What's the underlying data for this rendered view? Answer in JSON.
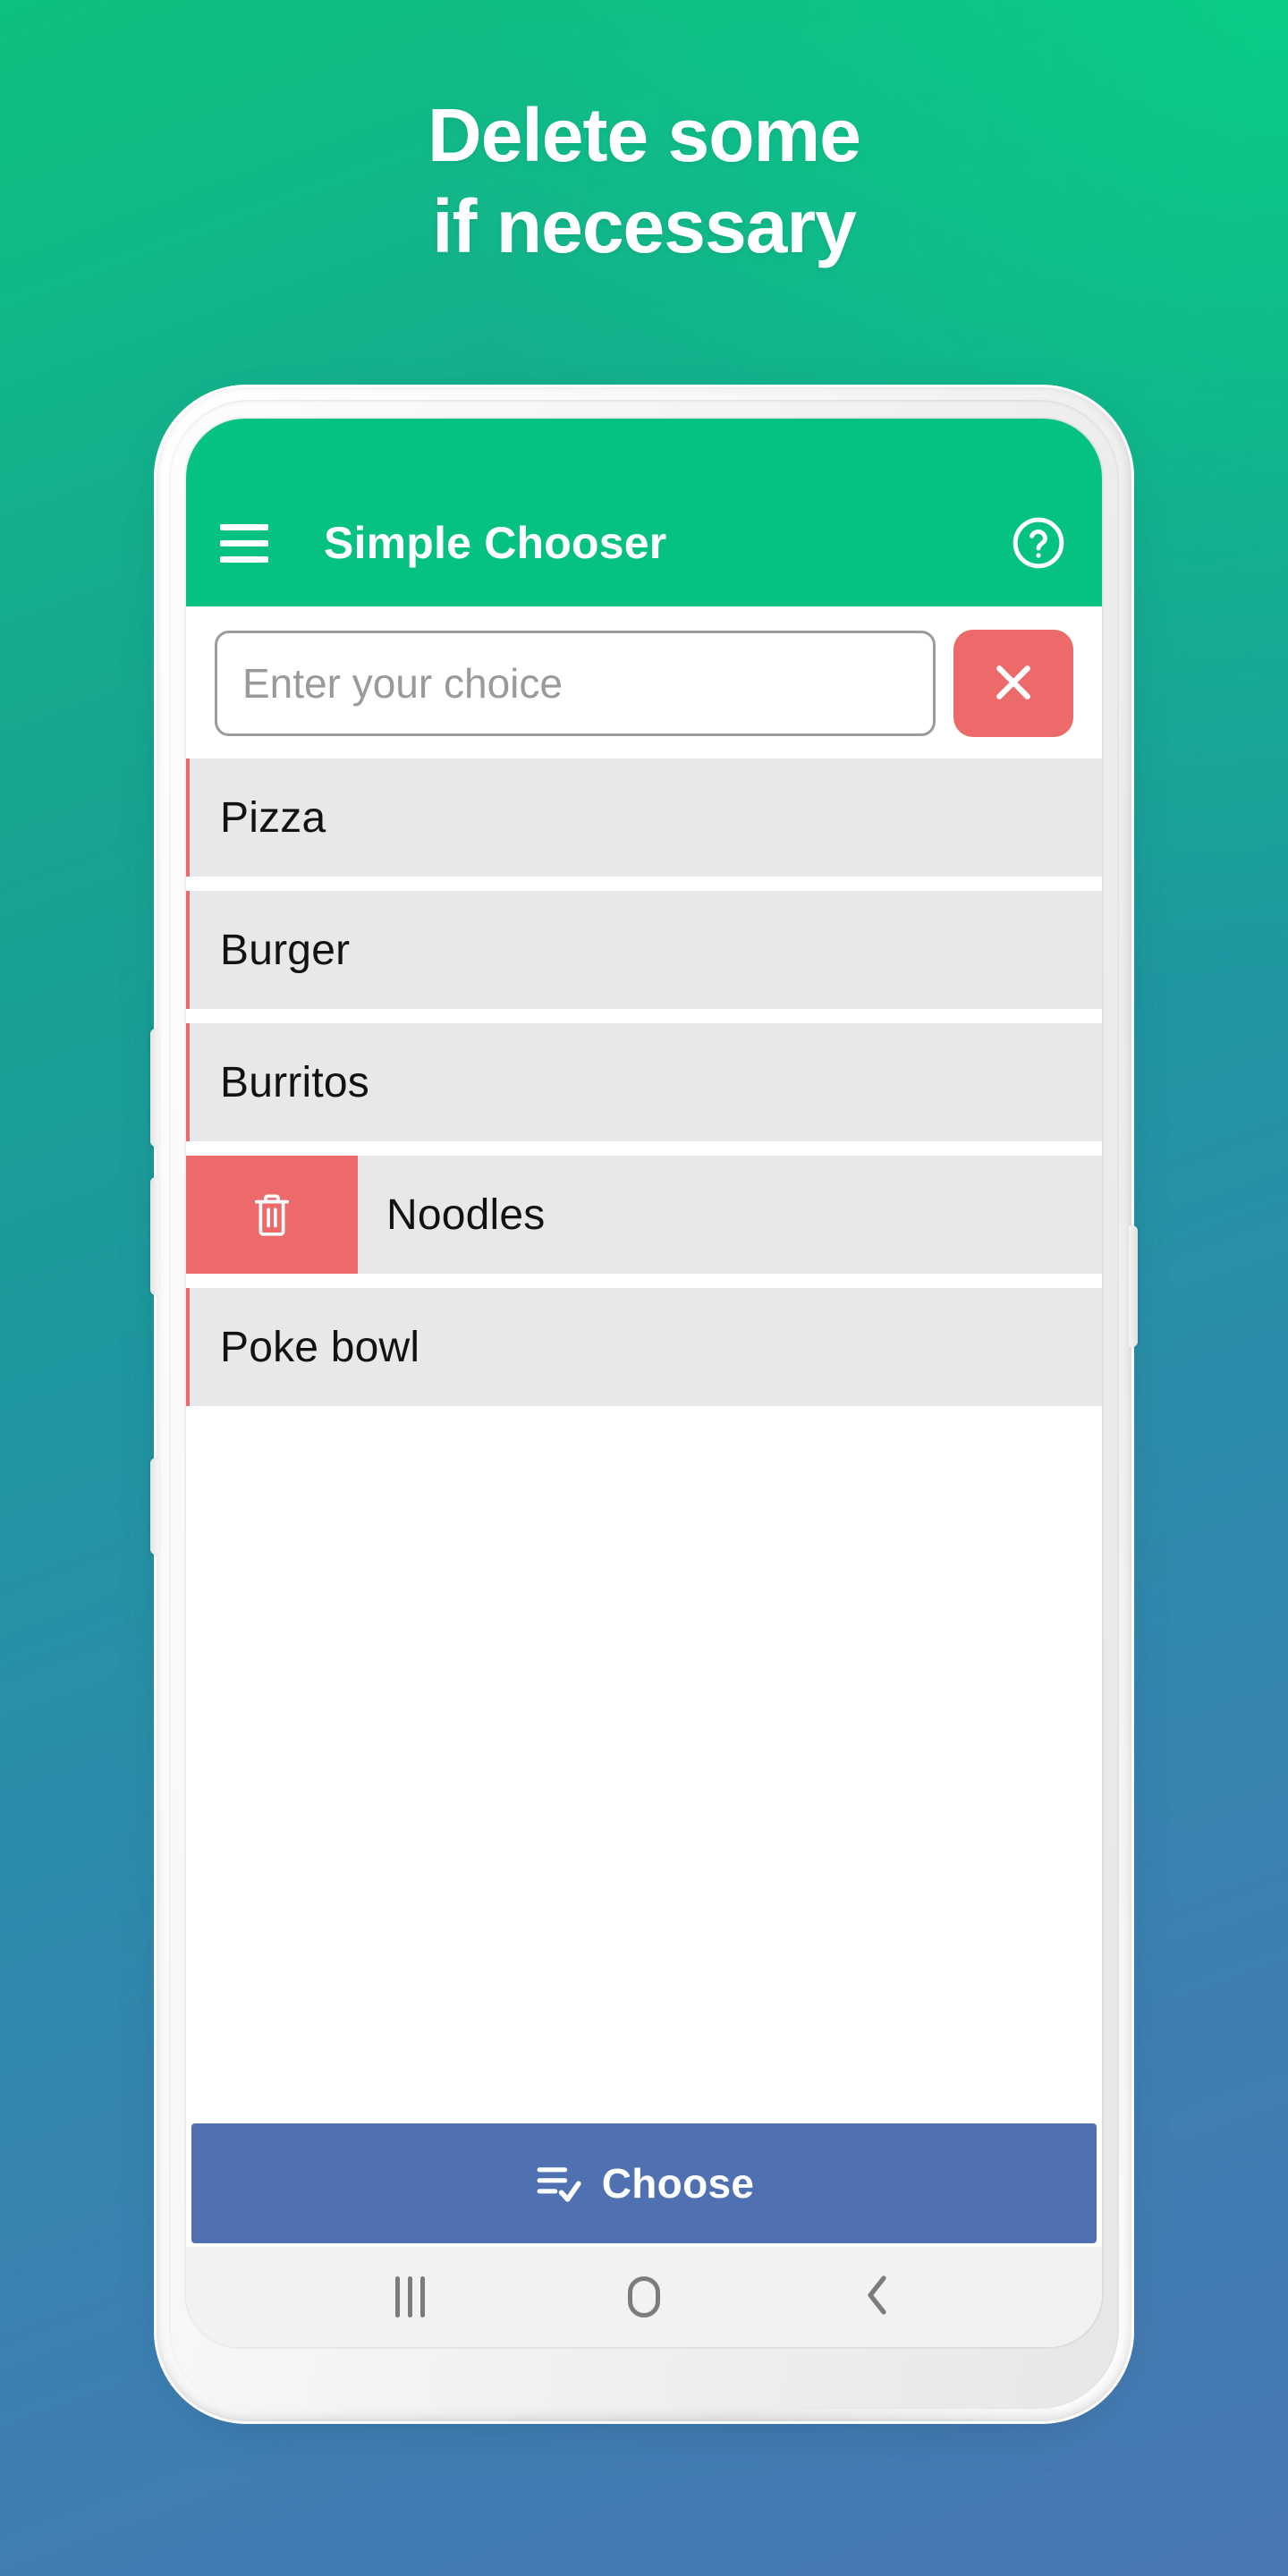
{
  "promo": {
    "headline_line1": "Delete some",
    "headline_line2": "if necessary",
    "bg_gradient_start": "#0dc07d",
    "bg_gradient_end": "#4a77b4"
  },
  "app": {
    "appbar": {
      "title": "Simple Chooser",
      "accent_color": "#05c281",
      "menu_icon": "hamburger-menu-icon",
      "help_icon": "help-circle-icon"
    },
    "input": {
      "value": "",
      "placeholder": "Enter your choice",
      "clear_button_label": "",
      "clear_icon": "close-x-icon",
      "clear_color": "#ed6a6a"
    },
    "list": {
      "row_bg": "#e7e8ea",
      "delete_bg": "#ed6a6a",
      "delete_icon": "trash-can-icon",
      "items": [
        {
          "label": "Pizza",
          "swiped": false
        },
        {
          "label": "Burger",
          "swiped": false
        },
        {
          "label": "Burritos",
          "swiped": false
        },
        {
          "label": "Noodles",
          "swiped": true
        },
        {
          "label": "Poke bowl",
          "swiped": false
        }
      ]
    },
    "choose_button": {
      "label": "Choose",
      "icon": "playlist-check-icon",
      "color": "#4f71b1"
    },
    "navbar": {
      "recents_label": "Recents",
      "home_label": "Home",
      "back_label": "Back"
    }
  }
}
